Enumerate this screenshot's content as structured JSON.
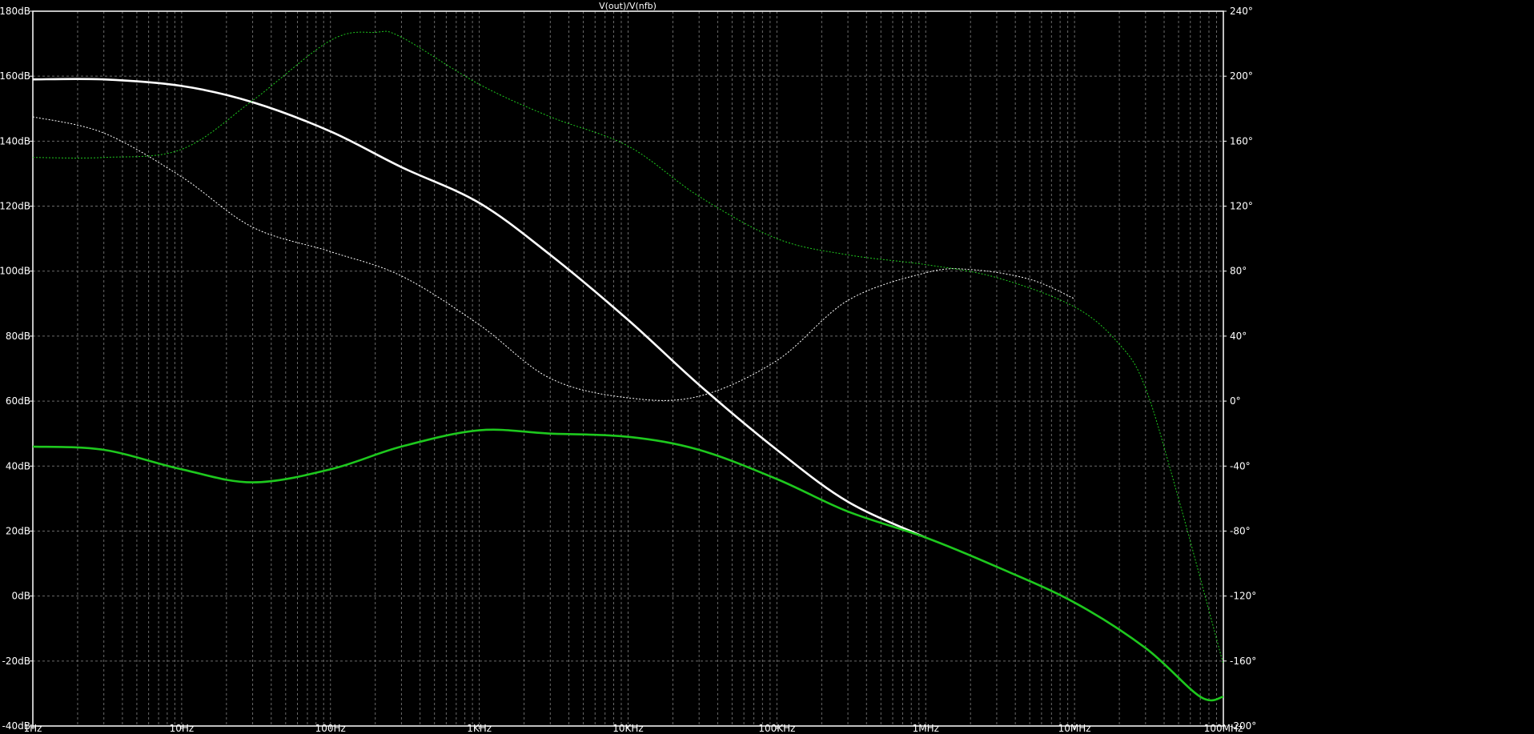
{
  "chart_data": {
    "type": "line",
    "title": "V(out)/V(nfb)",
    "x_scale": "log",
    "xlim_hz": [
      1,
      100000000
    ],
    "x_tick_labels": [
      "1Hz",
      "10Hz",
      "100Hz",
      "1KHz",
      "10KHz",
      "100KHz",
      "1MHz",
      "10MHz",
      "100MHz"
    ],
    "ylim_left_db": [
      -40,
      180
    ],
    "y_left_tick_labels": [
      "180dB",
      "160dB",
      "140dB",
      "120dB",
      "100dB",
      "80dB",
      "60dB",
      "40dB",
      "20dB",
      "0dB",
      "-20dB",
      "-40dB"
    ],
    "ylim_right_deg": [
      -200,
      240
    ],
    "y_right_tick_labels": [
      "240°",
      "200°",
      "160°",
      "120°",
      "80°",
      "40°",
      "0°",
      "-40°",
      "-80°",
      "-120°",
      "-160°",
      "-200°"
    ],
    "grid": true,
    "colors": {
      "background": "#000000",
      "white_trace": "#ffffff",
      "green_trace": "#1ec81e",
      "grid": "#6a6a6a",
      "axis": "#ffffff"
    },
    "series": [
      {
        "color": "#ffffff",
        "style": "solid",
        "axis": "left",
        "x": [
          1,
          3,
          10,
          30,
          100,
          300,
          1000,
          3000,
          10000,
          30000,
          100000,
          300000,
          1000000
        ],
        "y": [
          159,
          159,
          157,
          152,
          143,
          132,
          121,
          105,
          85,
          65,
          45,
          29,
          18
        ]
      },
      {
        "color": "#1ec81e",
        "style": "solid",
        "axis": "left",
        "x": [
          1,
          3,
          10,
          30,
          100,
          300,
          1000,
          3000,
          10000,
          30000,
          100000,
          300000,
          1000000,
          3000000,
          10000000,
          30000000,
          70000000,
          100000000
        ],
        "y": [
          46,
          45,
          39,
          35,
          39,
          46,
          51,
          50,
          49,
          45,
          36,
          26,
          18,
          9,
          -2,
          -16,
          -31,
          -31
        ]
      },
      {
        "color": "#ffffff",
        "style": "dashed",
        "axis": "right",
        "x": [
          1,
          3,
          10,
          30,
          100,
          300,
          1000,
          3000,
          10000,
          30000,
          100000,
          300000,
          1000000,
          2000000,
          5000000,
          10000000
        ],
        "y": [
          175,
          165,
          138,
          107,
          92,
          77,
          47,
          14,
          2,
          3,
          25,
          62,
          79,
          81,
          75,
          63
        ]
      },
      {
        "color": "#1ec81e",
        "style": "dashed",
        "axis": "right",
        "x": [
          1,
          3,
          10,
          30,
          100,
          200,
          300,
          1000,
          3000,
          10000,
          30000,
          100000,
          300000,
          1000000,
          3000000,
          10000000,
          20000000,
          30000000,
          50000000,
          100000000
        ],
        "y": [
          150,
          150,
          155,
          185,
          222,
          227,
          224,
          195,
          175,
          157,
          126,
          100,
          90,
          84,
          76,
          58,
          35,
          8,
          -60,
          -162
        ]
      }
    ]
  }
}
